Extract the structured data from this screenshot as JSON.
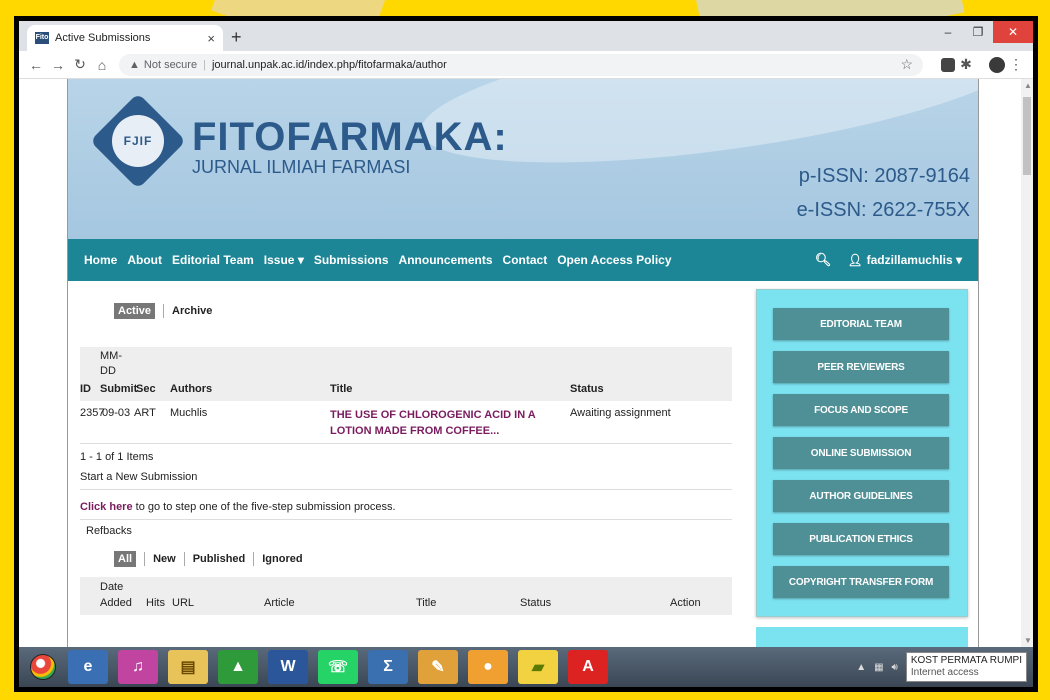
{
  "browser": {
    "tab_title": "Active Submissions",
    "tab_favicon": "Fito",
    "new_tab": "+",
    "security_label": "Not secure",
    "url": "journal.unpak.ac.id/index.php/fitofarmaka/author"
  },
  "banner": {
    "brand_name": "FITOFARMAKA:",
    "brand_sub": "JURNAL ILMIAH FARMASI",
    "logo_text": "FJIF",
    "issn_print": "p-ISSN: 2087-9164",
    "issn_electronic": "e-ISSN: 2622-755X"
  },
  "nav": {
    "items": [
      "Home",
      "About",
      "Editorial Team",
      "Issue ▾",
      "Submissions",
      "Announcements",
      "Contact",
      "Open Access Policy"
    ],
    "user": "fadzillamuchlis ▾"
  },
  "submissions": {
    "tabs": {
      "active": "Active",
      "archive": "Archive"
    },
    "headers": {
      "mm": "MM-",
      "dd": "DD",
      "id": "ID",
      "submit": "Submit",
      "sec": "Sec",
      "authors": "Authors",
      "title": "Title",
      "status": "Status"
    },
    "row": {
      "id": "2357",
      "date": "09-03",
      "sec": "ART",
      "author": "Muchlis",
      "title": "THE USE OF CHLOROGENIC ACID IN A LOTION MADE FROM COFFEE...",
      "status": "Awaiting assignment"
    },
    "items_count": "1 - 1 of 1 Items",
    "start_new": "Start a New Submission",
    "click_here": "Click here",
    "click_here_rest": " to go to step one of the five-step submission process."
  },
  "refbacks": {
    "title": "Refbacks",
    "tabs": {
      "all": "All",
      "new": "New",
      "published": "Published",
      "ignored": "Ignored"
    },
    "headers": {
      "date": "Date",
      "added": "Added",
      "hits": "Hits",
      "url": "URL",
      "article": "Article",
      "title": "Title",
      "status": "Status",
      "action": "Action"
    }
  },
  "sidebar": {
    "buttons": [
      "EDITORIAL TEAM",
      "PEER REVIEWERS",
      "FOCUS AND SCOPE",
      "ONLINE SUBMISSION",
      "AUTHOR GUIDELINES",
      "PUBLICATION ETHICS",
      "COPYRIGHT TRANSFER FORM"
    ]
  },
  "taskbar": {
    "tooltip_line1": "KOST PERMATA RUMPI",
    "tooltip_line2": "Internet access"
  }
}
